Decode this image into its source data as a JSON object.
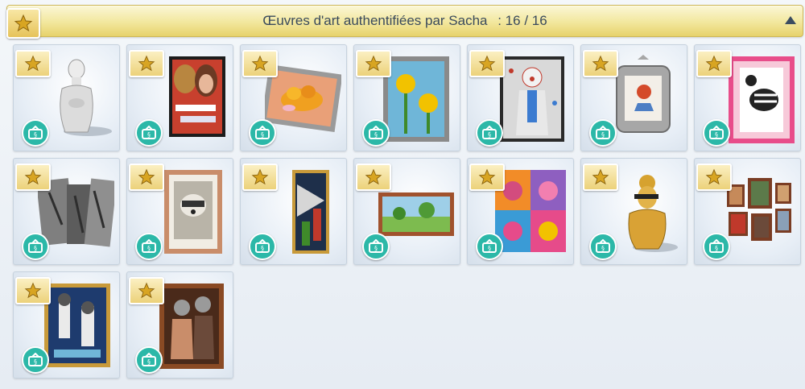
{
  "header": {
    "title": "Œuvres d'art authentifiées par Sacha",
    "count": ": 16 / 16",
    "star_icon": "star-icon",
    "collapse_icon": "collapse-up-icon"
  },
  "colors": {
    "header_gold": "#f2e79d",
    "star_gold": "#e6c35a",
    "buy_teal": "#2cb8a8"
  },
  "items": [
    {
      "name": "white-mannequin-bust-sculpture",
      "icon": "bust-icon"
    },
    {
      "name": "poster-painting",
      "icon": "painting-icon"
    },
    {
      "name": "fruit-bowl-painting",
      "icon": "painting-icon"
    },
    {
      "name": "sunflowers-painting",
      "icon": "painting-icon"
    },
    {
      "name": "clown-painting",
      "icon": "painting-icon"
    },
    {
      "name": "ornate-frame-rooster-painting",
      "icon": "painting-icon"
    },
    {
      "name": "zebra-creature-painting",
      "icon": "painting-icon"
    },
    {
      "name": "grey-abstract-sculpture",
      "icon": "sculpture-icon"
    },
    {
      "name": "raccoon-portrait-painting",
      "icon": "painting-icon"
    },
    {
      "name": "tall-abstract-painting",
      "icon": "painting-icon"
    },
    {
      "name": "landscape-painting",
      "icon": "painting-icon"
    },
    {
      "name": "pop-art-cats-painting",
      "icon": "painting-icon"
    },
    {
      "name": "gold-bust-sculpture",
      "icon": "bust-icon"
    },
    {
      "name": "frame-collage-wall-art",
      "icon": "painting-icon"
    },
    {
      "name": "raccoon-night-painting",
      "icon": "painting-icon"
    },
    {
      "name": "raccoon-couple-painting",
      "icon": "painting-icon"
    }
  ],
  "badge": {
    "buy_icon": "price-tag-icon"
  }
}
